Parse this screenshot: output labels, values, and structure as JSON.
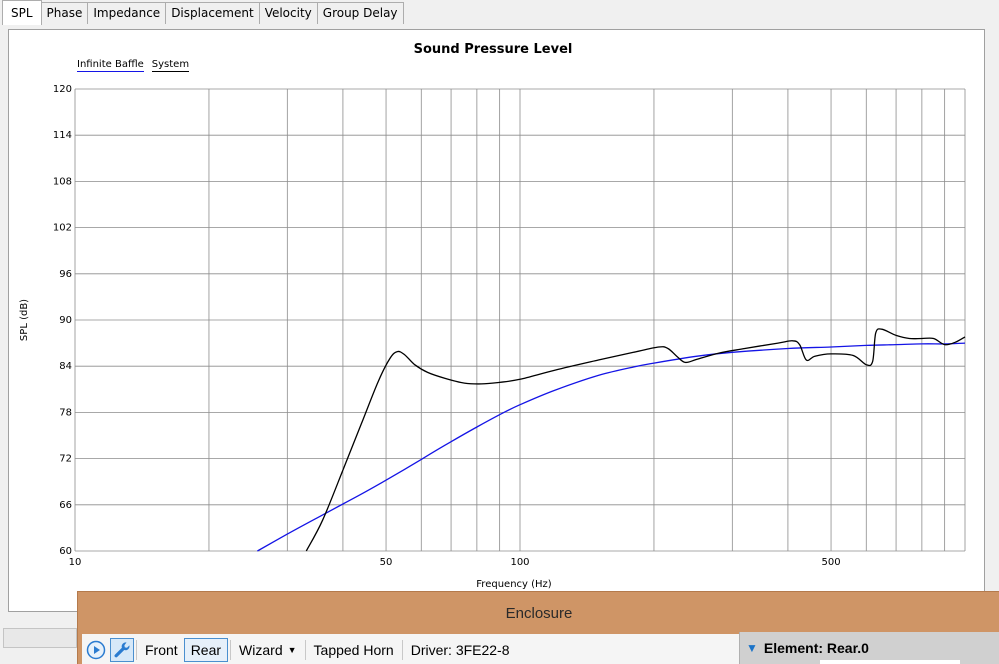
{
  "tabs": [
    {
      "label": "SPL",
      "active": true
    },
    {
      "label": "Phase",
      "active": false
    },
    {
      "label": "Impedance",
      "active": false
    },
    {
      "label": "Displacement",
      "active": false
    },
    {
      "label": "Velocity",
      "active": false
    },
    {
      "label": "Group Delay",
      "active": false
    }
  ],
  "chart_data": {
    "type": "line",
    "title": "Sound Pressure Level",
    "xlabel": "Frequency (Hz)",
    "ylabel": "SPL (dB)",
    "xscale": "log",
    "xlim": [
      10,
      1000
    ],
    "ylim": [
      60,
      120
    ],
    "xticks": [
      10,
      50,
      100,
      500
    ],
    "xtick_labels": [
      "10",
      "50",
      "100",
      "500"
    ],
    "yticks": [
      60,
      66,
      72,
      78,
      84,
      90,
      96,
      102,
      108,
      114,
      120
    ],
    "grid": true,
    "legend_placement": "top-left",
    "series": [
      {
        "name": "Infinite Baffle",
        "color": "#1414e6",
        "x": [
          25.7,
          30,
          35,
          40,
          45,
          50,
          55,
          60,
          70,
          80,
          90,
          100,
          120,
          150,
          180,
          200,
          250,
          300,
          400,
          500,
          600,
          700,
          800,
          900,
          1000
        ],
        "y": [
          60.0,
          62.2,
          64.3,
          66.1,
          67.7,
          69.2,
          70.6,
          71.9,
          74.2,
          76.1,
          77.7,
          79.0,
          80.9,
          82.8,
          83.9,
          84.4,
          85.3,
          85.8,
          86.3,
          86.5,
          86.7,
          86.8,
          86.9,
          86.9,
          87.0
        ]
      },
      {
        "name": "System",
        "color": "#000000",
        "x": [
          33.1,
          36,
          40,
          44,
          48,
          51,
          53,
          55,
          58,
          62,
          68,
          75,
          82,
          90,
          100,
          120,
          150,
          180,
          205,
          215,
          225,
          235,
          250,
          280,
          320,
          380,
          410,
          425,
          440,
          460,
          500,
          560,
          600,
          620,
          630,
          650,
          700,
          750,
          800,
          850,
          900,
          950,
          1000
        ],
        "y": [
          60.0,
          64.0,
          70.5,
          76.5,
          82.0,
          85.0,
          85.9,
          85.5,
          84.2,
          83.2,
          82.4,
          81.8,
          81.7,
          81.9,
          82.3,
          83.5,
          84.8,
          85.8,
          86.5,
          86.3,
          85.3,
          84.5,
          84.9,
          85.7,
          86.3,
          87.0,
          87.3,
          86.8,
          84.8,
          85.3,
          85.6,
          85.4,
          84.2,
          84.6,
          88.3,
          88.8,
          88.0,
          87.6,
          87.6,
          87.6,
          86.8,
          87.1,
          87.8
        ]
      }
    ]
  },
  "enclosure": {
    "title": "Enclosure",
    "toolbar": {
      "front_label": "Front",
      "rear_label": "Rear",
      "wizard_label": "Wizard",
      "wizard_dropdown": "▼",
      "horn_label": "Tapped Horn",
      "driver_label": "Driver: 3FE22-8"
    }
  },
  "element_panel": {
    "triangle": "▼",
    "label": "Element: Rear.0"
  },
  "colors": {
    "enclosure_title_bar": "#cf9566",
    "accent_blue": "#1a73c8"
  }
}
